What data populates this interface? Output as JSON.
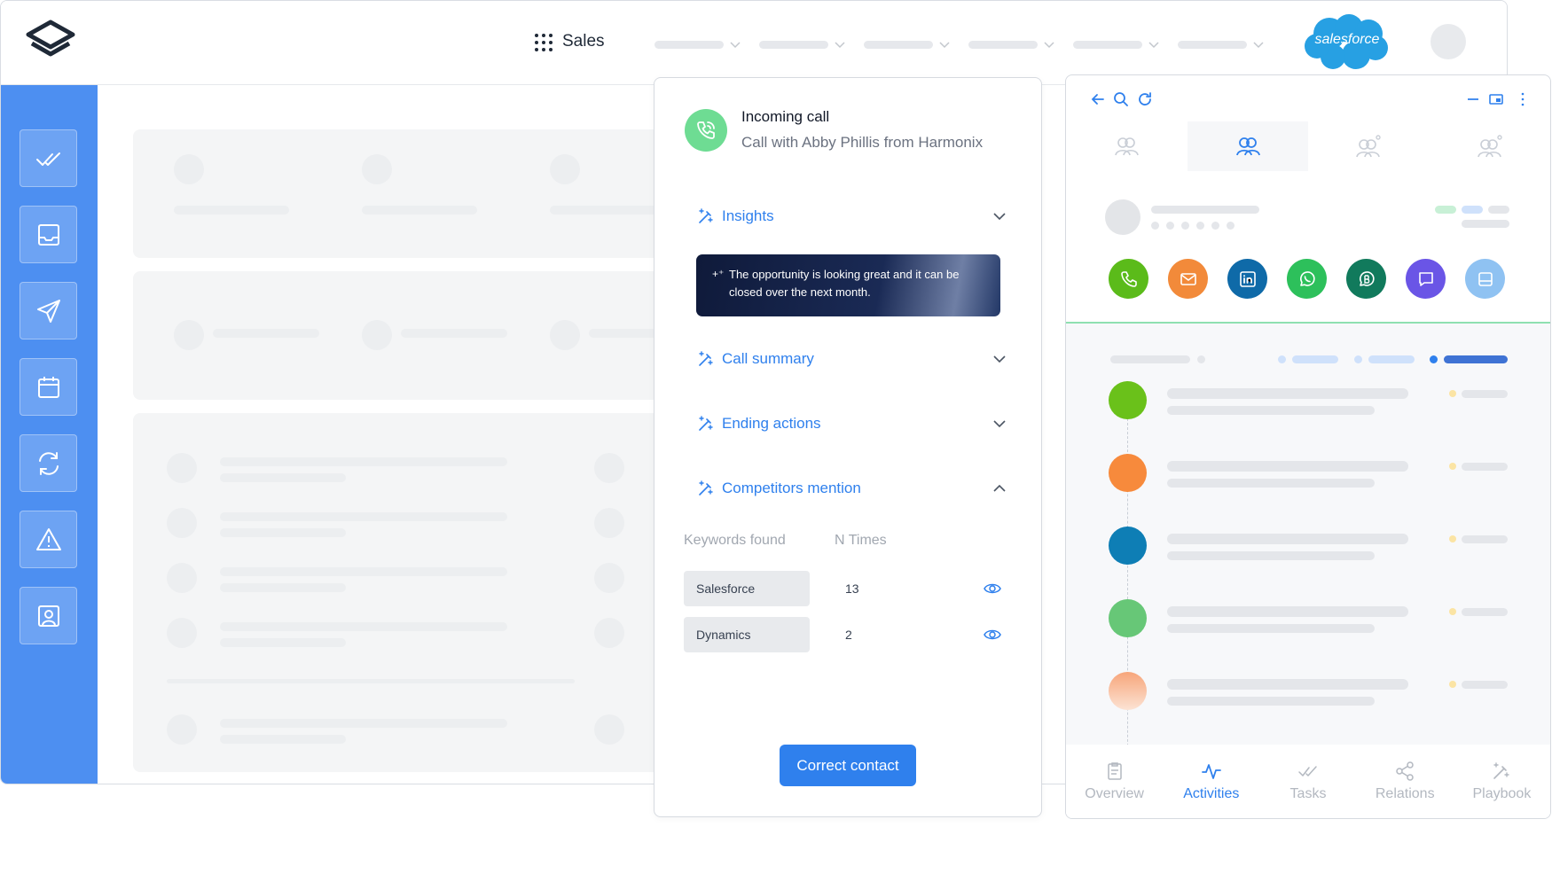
{
  "topbar": {
    "app_name": "Sales",
    "crm_logo_text": "salesforce",
    "nav_items": [
      "",
      "",
      "",
      "",
      "",
      ""
    ]
  },
  "sidebar": {
    "items": [
      {
        "icon": "double-check-icon"
      },
      {
        "icon": "inbox-icon"
      },
      {
        "icon": "send-icon"
      },
      {
        "icon": "calendar-icon"
      },
      {
        "icon": "sync-icon"
      },
      {
        "icon": "alert-icon"
      },
      {
        "icon": "contact-card-icon"
      }
    ],
    "color": "#4d8ff1"
  },
  "call_panel": {
    "title": "Incoming call",
    "subtitle": "Call with Abby Phillis from Harmonix",
    "sections": {
      "insights": "Insights",
      "call_summary": "Call summary",
      "ending_actions": "Ending actions",
      "competitors": "Competitors mention"
    },
    "insight_text": "The opportunity is looking great and it can be closed over the next month.",
    "keywords_header": "Keywords found",
    "times_header": "N Times",
    "keywords": [
      {
        "name": "Salesforce",
        "count": "13"
      },
      {
        "name": "Dynamics",
        "count": "2"
      }
    ],
    "action_label": "Correct contact",
    "accent": "#2f80ed",
    "call_color": "#6edc93"
  },
  "crm_panel": {
    "channels": [
      {
        "icon": "phone-icon",
        "color": "#5bbb1a"
      },
      {
        "icon": "mail-icon",
        "color": "#f28a3a"
      },
      {
        "icon": "linkedin-icon",
        "color": "#0f6aa8"
      },
      {
        "icon": "whatsapp-icon",
        "color": "#2dc05b"
      },
      {
        "icon": "business-chat-icon",
        "color": "#117a5c"
      },
      {
        "icon": "message-icon",
        "color": "#6a55e6"
      },
      {
        "icon": "browser-icon",
        "color": "#8fc2f2"
      }
    ],
    "timeline_colors": [
      "#6ac11a",
      "#f78a3c",
      "#0e7eb5",
      "#67c777",
      "#f8b48f"
    ],
    "bottom_nav": [
      {
        "label": "Overview",
        "icon": "clipboard-icon"
      },
      {
        "label": "Activities",
        "icon": "activity-icon"
      },
      {
        "label": "Tasks",
        "icon": "checks-icon"
      },
      {
        "label": "Relations",
        "icon": "share-icon"
      },
      {
        "label": "Playbook",
        "icon": "magic-wand-icon"
      }
    ]
  }
}
